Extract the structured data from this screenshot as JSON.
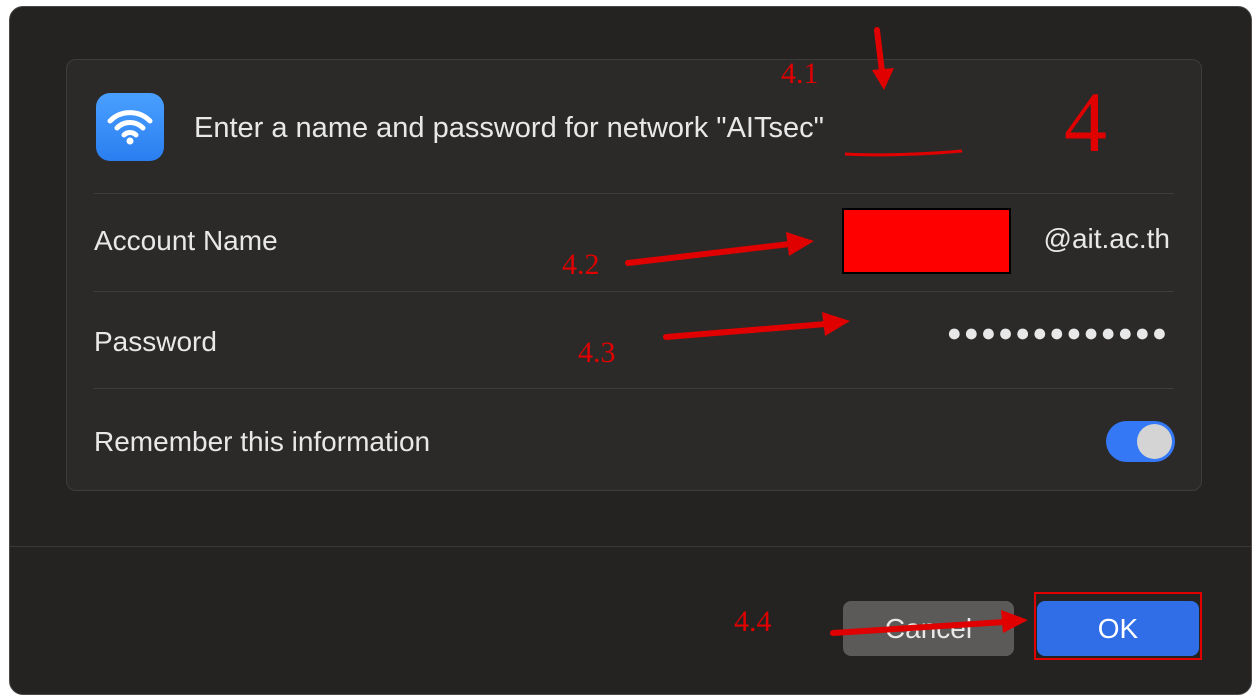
{
  "dialog": {
    "header_text": "Enter a name and password for network \"AITsec\"",
    "account_label": "Account Name",
    "account_value": "@ait.ac.th",
    "password_label": "Password",
    "password_value": "●●●●●●●●●●●●●",
    "remember_label": "Remember this information",
    "remember_on": true,
    "cancel_label": "Cancel",
    "ok_label": "OK"
  },
  "annotations": {
    "step": "4",
    "step_1": "4.1",
    "step_2": "4.2",
    "step_3": "4.3",
    "step_4": "4.4"
  },
  "colors": {
    "accent": "#3478f6",
    "annotation": "#e00000",
    "redaction": "#ff0000"
  }
}
